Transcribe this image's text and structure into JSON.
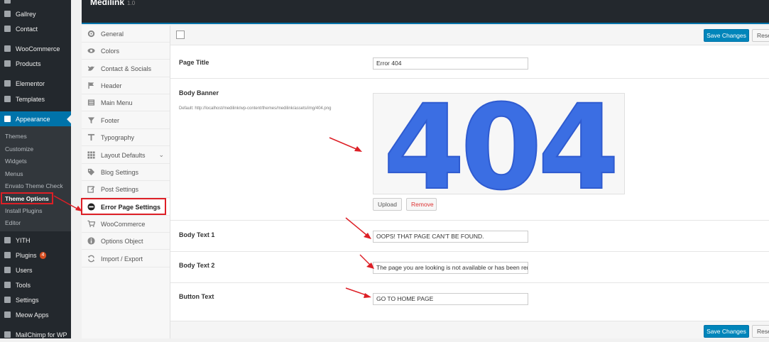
{
  "wp_sidebar": {
    "top_items": [
      {
        "label": "Gallrey",
        "icon": "gallery-icon"
      },
      {
        "label": "Contact",
        "icon": "mail-icon"
      },
      {
        "label": "WooCommerce",
        "icon": "woocommerce-icon"
      },
      {
        "label": "Products",
        "icon": "box-icon"
      },
      {
        "label": "Elementor",
        "icon": "elementor-icon"
      },
      {
        "label": "Templates",
        "icon": "folder-icon"
      },
      {
        "label": "Appearance",
        "icon": "brush-icon"
      }
    ],
    "sub_items": [
      "Themes",
      "Customize",
      "Widgets",
      "Menus",
      "Envato Theme Check",
      "Theme Options",
      "Install Plugins",
      "Editor"
    ],
    "bottom_items": [
      {
        "label": "YITH",
        "icon": "yith-icon"
      },
      {
        "label": "Plugins",
        "icon": "plugin-icon",
        "badge": "4"
      },
      {
        "label": "Users",
        "icon": "user-icon"
      },
      {
        "label": "Tools",
        "icon": "wrench-icon"
      },
      {
        "label": "Settings",
        "icon": "settings-icon"
      },
      {
        "label": "Meow Apps",
        "icon": "meow-icon"
      },
      {
        "label": "MailChimp for WP",
        "icon": "mailchimp-icon"
      }
    ]
  },
  "header": {
    "brand": "Medilink",
    "version": "1.0"
  },
  "options_menu": [
    {
      "label": "General",
      "icon": "gear-icon"
    },
    {
      "label": "Colors",
      "icon": "eye-icon"
    },
    {
      "label": "Contact & Socials",
      "icon": "twitter-icon"
    },
    {
      "label": "Header",
      "icon": "flag-icon"
    },
    {
      "label": "Main Menu",
      "icon": "menu-icon"
    },
    {
      "label": "Footer",
      "icon": "filter-icon"
    },
    {
      "label": "Typography",
      "icon": "text-icon"
    },
    {
      "label": "Layout Defaults",
      "icon": "grid-icon"
    },
    {
      "label": "Blog Settings",
      "icon": "tags-icon"
    },
    {
      "label": "Post Settings",
      "icon": "edit-icon"
    },
    {
      "label": "Error Page Settings",
      "icon": "minus-circle-icon"
    },
    {
      "label": "WooCommerce",
      "icon": "cart-icon"
    },
    {
      "label": "Options Object",
      "icon": "info-icon"
    },
    {
      "label": "Import / Export",
      "icon": "refresh-icon"
    }
  ],
  "toolbar": {
    "save": "Save Changes",
    "reset": "Reset"
  },
  "fields": {
    "page_title": {
      "label": "Page Title",
      "value": "Error 404"
    },
    "body_banner": {
      "label": "Body Banner",
      "desc": "Default: http://localhost/medilink/wp-content/themes/medilink/assets/img/404.png",
      "image_text": "404",
      "upload": "Upload",
      "remove": "Remove"
    },
    "body_text_1": {
      "label": "Body Text 1",
      "value": "OOPS! THAT PAGE CAN'T BE FOUND."
    },
    "body_text_2": {
      "label": "Body Text 2",
      "value": "The page you are looking is not available or has been removed."
    },
    "button_text": {
      "label": "Button Text",
      "value": "GO TO HOME PAGE"
    }
  },
  "colors": {
    "accent": "#0085ba",
    "annotation": "#dd1f26",
    "banner_blue": "#3b6ee3"
  }
}
